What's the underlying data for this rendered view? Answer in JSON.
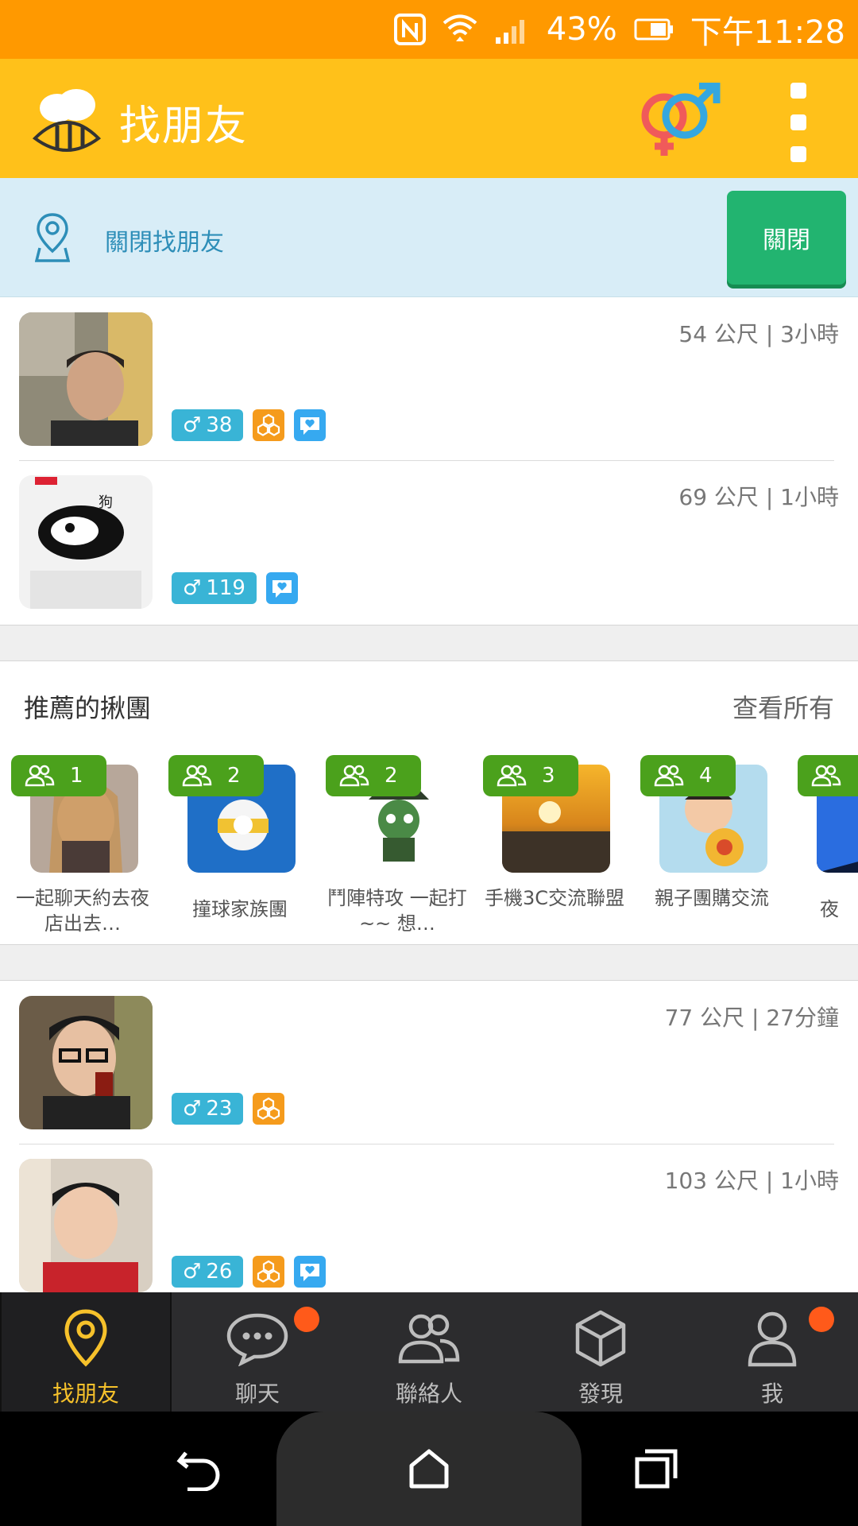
{
  "status_bar": {
    "battery": "43%",
    "time": "下午11:28",
    "nfc_icon": "nfc-icon",
    "wifi_icon": "wifi-icon",
    "signal_icon": "signal-icon",
    "battery_icon": "battery-icon",
    "bg_color": "#FF9900"
  },
  "app_bar": {
    "title": "找朋友",
    "logo_icon": "bee-chat-logo-icon",
    "gender_icon": "gender-filter-icon",
    "menu_icon": "overflow-menu-icon",
    "bg_color": "#FFC11A"
  },
  "banner": {
    "text": "關閉找朋友",
    "icon": "location-pin-icon",
    "button_label": "關閉",
    "button_color": "#22B470"
  },
  "users_top": [
    {
      "distance_time": "54 公尺 | 3小時",
      "age": "38",
      "badges": [
        "group-icon",
        "chat-heart-icon"
      ]
    },
    {
      "distance_time": "69 公尺 | 1小時",
      "age": "119",
      "badges": [
        "chat-heart-icon"
      ]
    }
  ],
  "groups": {
    "title": "推薦的揪團",
    "see_all": "查看所有",
    "items": [
      {
        "count": "1",
        "name": "一起聊天約去夜店出去…"
      },
      {
        "count": "2",
        "name": "撞球家族團"
      },
      {
        "count": "2",
        "name": "鬥陣特攻 一起打~~ 想…"
      },
      {
        "count": "3",
        "name": "手機3C交流聯盟"
      },
      {
        "count": "4",
        "name": "親子團購交流"
      },
      {
        "count": "",
        "name": "夜"
      }
    ]
  },
  "users_bottom": [
    {
      "distance_time": "77 公尺 | 27分鐘",
      "age": "23",
      "badges": [
        "group-icon"
      ]
    },
    {
      "distance_time": "103 公尺 | 1小時",
      "age": "26",
      "badges": [
        "group-icon",
        "chat-heart-icon"
      ]
    }
  ],
  "bottom_nav": {
    "items": [
      {
        "label": "找朋友",
        "icon": "location-pin-icon",
        "active": true
      },
      {
        "label": "聊天",
        "icon": "chat-bubble-icon",
        "badge": true
      },
      {
        "label": "聯絡人",
        "icon": "contacts-icon"
      },
      {
        "label": "發現",
        "icon": "cube-icon"
      },
      {
        "label": "我",
        "icon": "profile-icon",
        "badge": true
      }
    ],
    "active_color": "#F6C12B"
  },
  "system_nav": {
    "back_icon": "back-icon",
    "home_icon": "home-icon",
    "recents_icon": "recents-icon"
  }
}
